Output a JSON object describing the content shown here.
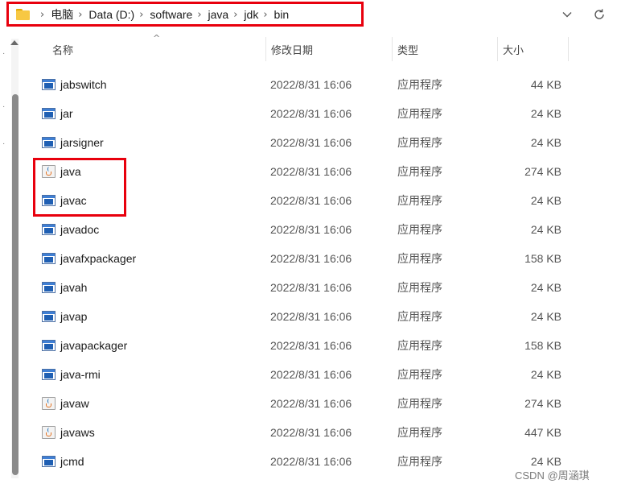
{
  "address_bar": {
    "crumbs": [
      "电脑",
      "Data (D:)",
      "software",
      "java",
      "jdk",
      "bin"
    ],
    "separator": "›"
  },
  "columns": {
    "name": "名称",
    "date": "修改日期",
    "type": "类型",
    "size": "大小"
  },
  "files": [
    {
      "name": "jabswitch",
      "date": "2022/8/31 16:06",
      "type": "应用程序",
      "size": "44 KB",
      "icon": "exe-icon"
    },
    {
      "name": "jar",
      "date": "2022/8/31 16:06",
      "type": "应用程序",
      "size": "24 KB",
      "icon": "exe-icon"
    },
    {
      "name": "jarsigner",
      "date": "2022/8/31 16:06",
      "type": "应用程序",
      "size": "24 KB",
      "icon": "exe-icon"
    },
    {
      "name": "java",
      "date": "2022/8/31 16:06",
      "type": "应用程序",
      "size": "274 KB",
      "icon": "java-icon"
    },
    {
      "name": "javac",
      "date": "2022/8/31 16:06",
      "type": "应用程序",
      "size": "24 KB",
      "icon": "exe-icon"
    },
    {
      "name": "javadoc",
      "date": "2022/8/31 16:06",
      "type": "应用程序",
      "size": "24 KB",
      "icon": "exe-icon"
    },
    {
      "name": "javafxpackager",
      "date": "2022/8/31 16:06",
      "type": "应用程序",
      "size": "158 KB",
      "icon": "exe-icon"
    },
    {
      "name": "javah",
      "date": "2022/8/31 16:06",
      "type": "应用程序",
      "size": "24 KB",
      "icon": "exe-icon"
    },
    {
      "name": "javap",
      "date": "2022/8/31 16:06",
      "type": "应用程序",
      "size": "24 KB",
      "icon": "exe-icon"
    },
    {
      "name": "javapackager",
      "date": "2022/8/31 16:06",
      "type": "应用程序",
      "size": "158 KB",
      "icon": "exe-icon"
    },
    {
      "name": "java-rmi",
      "date": "2022/8/31 16:06",
      "type": "应用程序",
      "size": "24 KB",
      "icon": "exe-icon"
    },
    {
      "name": "javaw",
      "date": "2022/8/31 16:06",
      "type": "应用程序",
      "size": "274 KB",
      "icon": "java-icon"
    },
    {
      "name": "javaws",
      "date": "2022/8/31 16:06",
      "type": "应用程序",
      "size": "447 KB",
      "icon": "java-icon"
    },
    {
      "name": "jcmd",
      "date": "2022/8/31 16:06",
      "type": "应用程序",
      "size": "24 KB",
      "icon": "exe-icon"
    }
  ],
  "watermark": "CSDN @周涵琪",
  "colors": {
    "highlight": "#e8000d",
    "folder": "#f7c843",
    "exe_icon": "#1f5fb3",
    "java_cup": "#e37222"
  }
}
